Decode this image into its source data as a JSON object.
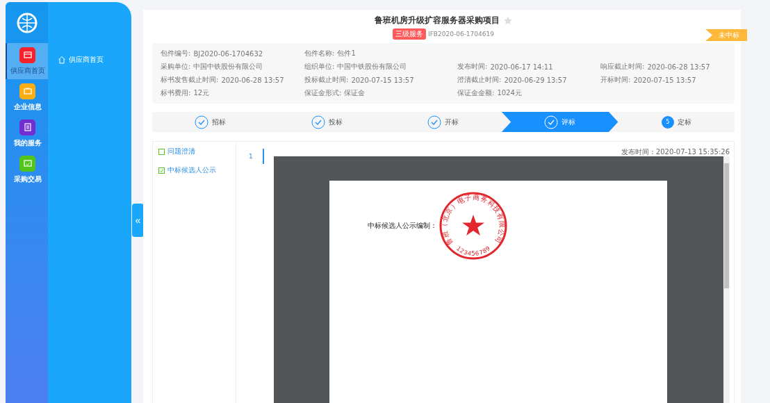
{
  "rail": {
    "items": [
      {
        "label": "供应商首页",
        "color": "#f5222d",
        "selected": true
      },
      {
        "label": "企业信息",
        "color": "#faad14",
        "selected": false
      },
      {
        "label": "我的服务",
        "color": "#722ed1",
        "selected": false
      },
      {
        "label": "采购交易",
        "color": "#52c41a",
        "selected": false
      }
    ]
  },
  "submenu": {
    "items": [
      {
        "label": "供应商首页"
      }
    ]
  },
  "collapse_button": {
    "label": "«"
  },
  "project": {
    "title": "鲁班机房升级扩容服务器采购项目",
    "starred": false,
    "tag": "三级服务",
    "code": "IFB2020-06-1704619",
    "ribbon": "未中标"
  },
  "info_rows": [
    [
      {
        "label": "包件编号:",
        "value": "BJ2020-06-1704632"
      },
      {
        "label": "包件名称:",
        "value": "包件1"
      }
    ],
    [
      {
        "label": "采购单位:",
        "value": "中国中铁股份有限公司"
      },
      {
        "label": "组织单位:",
        "value": "中国中铁股份有限公司"
      },
      {
        "label": "发布时间:",
        "value": "2020-06-17 14:11"
      },
      {
        "label": "响应截止时间:",
        "value": "2020-06-28 13:57"
      }
    ],
    [
      {
        "label": "标书发售截止时间:",
        "value": "2020-06-28 13:57"
      },
      {
        "label": "投标截止时间:",
        "value": "2020-07-15 13:57"
      },
      {
        "label": "澄清截止时间:",
        "value": "2020-06-29 13:57"
      },
      {
        "label": "开标时间:",
        "value": "2020-07-15 13:57"
      }
    ],
    [
      {
        "label": "标书费用:",
        "value": "12元"
      },
      {
        "label": "保证金形式:",
        "value": "保证金"
      },
      {
        "label": "保证金金额:",
        "value": "1024元"
      }
    ]
  ],
  "steps": [
    {
      "label": "招标",
      "kind": "done",
      "selected": false
    },
    {
      "label": "投标",
      "kind": "done",
      "selected": false
    },
    {
      "label": "开标",
      "kind": "done",
      "selected": false
    },
    {
      "label": "评标",
      "kind": "done",
      "selected": true
    },
    {
      "label": "定标",
      "kind": "todo",
      "number": "5",
      "selected": false
    }
  ],
  "documents": [
    {
      "label": "问题澄清",
      "checked": false
    },
    {
      "label": "中标候选人公示",
      "checked": true
    }
  ],
  "pages": [
    {
      "label": "1",
      "selected": true
    }
  ],
  "viewer": {
    "published": "发布时间 : 2020-07-13 15:35:26",
    "page_text": "中标候选人公示编制：",
    "seal_text": "鲁班（北京）电子商务科技有限公司",
    "seal_number": "123456789"
  }
}
